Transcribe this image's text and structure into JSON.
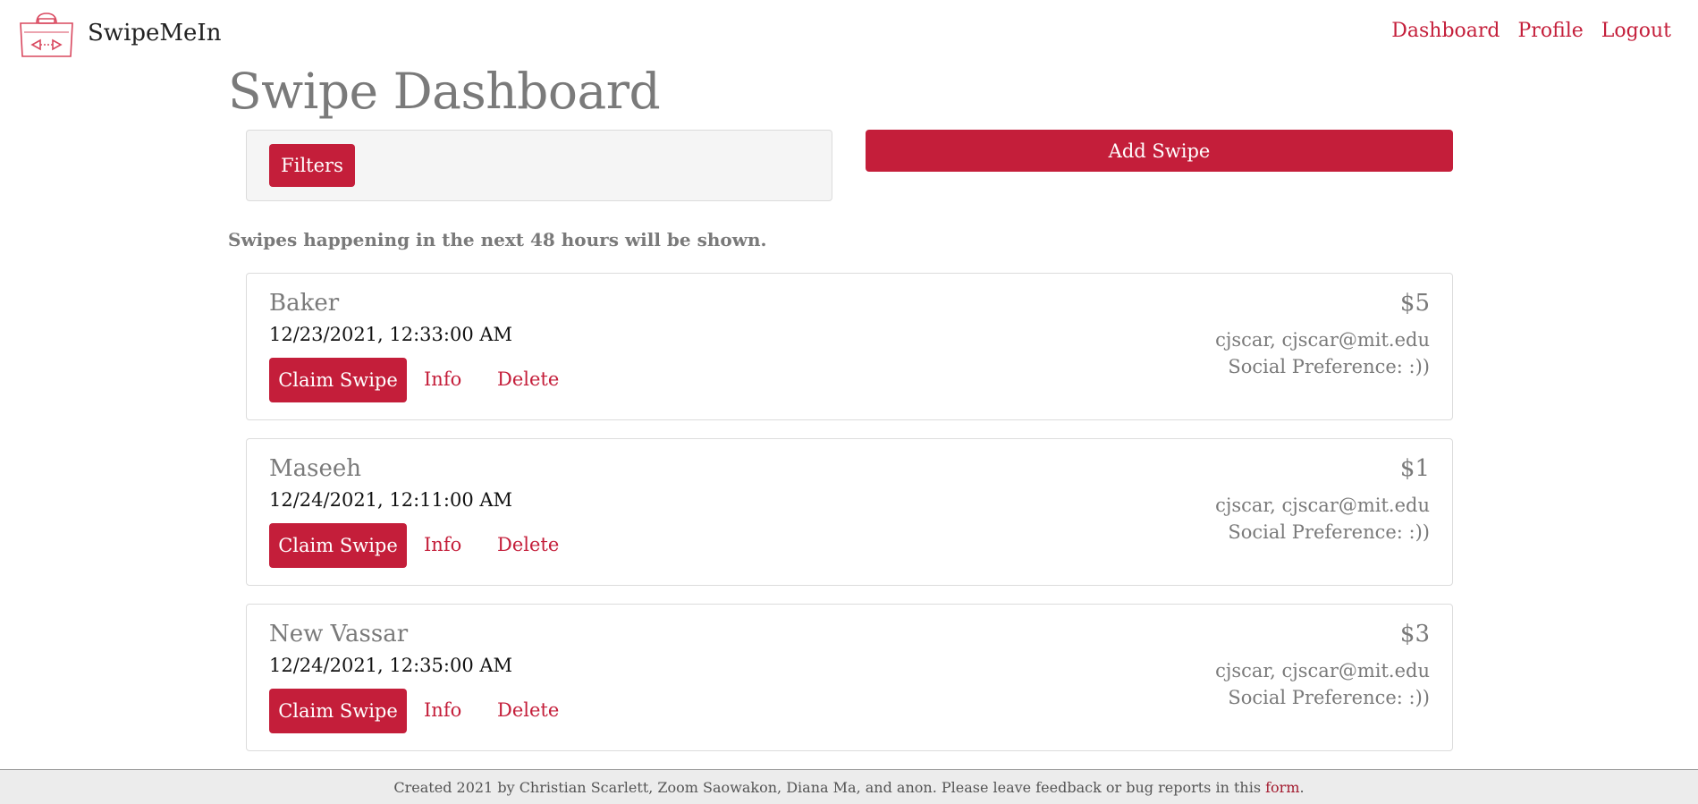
{
  "app": {
    "brand_name": "SwipeMeIn",
    "logo_icon": "swipe-card-logo-icon",
    "brand_color": "#c41e3a"
  },
  "nav": {
    "items": [
      {
        "label": "Dashboard"
      },
      {
        "label": "Profile"
      },
      {
        "label": "Logout"
      }
    ]
  },
  "page": {
    "title": "Swipe Dashboard",
    "filters_label": "Filters",
    "add_swipe_label": "Add Swipe",
    "info_text": "Swipes happening in the next 48 hours will be shown."
  },
  "swipes": [
    {
      "location": "Baker",
      "datetime": "12/23/2021, 12:33:00 AM",
      "price": "$5",
      "user": "cjscar, cjscar@mit.edu",
      "social": "Social Preference: :))",
      "claim_label": "Claim Swipe",
      "info_label": "Info",
      "delete_label": "Delete"
    },
    {
      "location": "Maseeh",
      "datetime": "12/24/2021, 12:11:00 AM",
      "price": "$1",
      "user": "cjscar, cjscar@mit.edu",
      "social": "Social Preference: :))",
      "claim_label": "Claim Swipe",
      "info_label": "Info",
      "delete_label": "Delete"
    },
    {
      "location": "New Vassar",
      "datetime": "12/24/2021, 12:35:00 AM",
      "price": "$3",
      "user": "cjscar, cjscar@mit.edu",
      "social": "Social Preference: :))",
      "claim_label": "Claim Swipe",
      "info_label": "Info",
      "delete_label": "Delete"
    }
  ],
  "footer": {
    "text": "Created 2021 by Christian Scarlett, Zoom Saowakon, Diana Ma, and anon. Please leave feedback or bug reports in this ",
    "link_label": "form",
    "suffix": "."
  }
}
